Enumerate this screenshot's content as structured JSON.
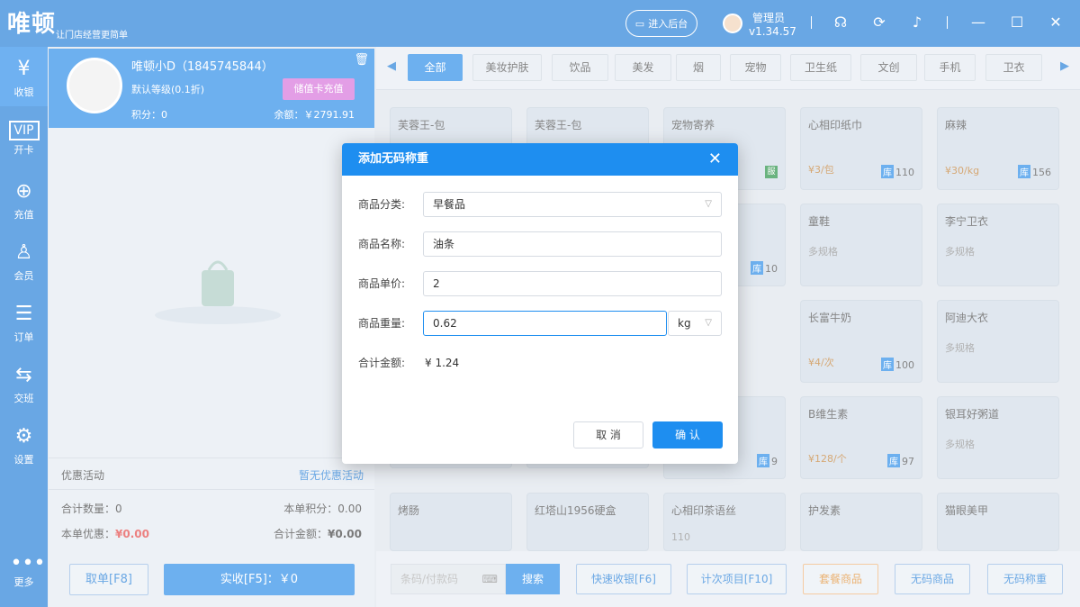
{
  "topbar": {
    "logo": "唯顿",
    "slogan": "让门店经营更简单",
    "admin_label": "进入后台",
    "user_name": "管理员",
    "version": "v1.34.57"
  },
  "nav": [
    {
      "label": "收银",
      "icon": "cashier-icon"
    },
    {
      "label": "开卡",
      "icon": "vip-card-icon"
    },
    {
      "label": "充值",
      "icon": "recharge-icon"
    },
    {
      "label": "会员",
      "icon": "member-icon"
    },
    {
      "label": "订单",
      "icon": "order-icon"
    },
    {
      "label": "交班",
      "icon": "shift-icon"
    },
    {
      "label": "设置",
      "icon": "settings-icon"
    },
    {
      "label": "更多",
      "icon": "more-icon"
    }
  ],
  "member": {
    "name": "唯顿小D（1845745844）",
    "level": "默认等级(0.1折)",
    "points": "积分：0",
    "balance": "余额：￥2791.91",
    "charge_label": "储值卡充值"
  },
  "summary": {
    "promo_label": "优惠活动",
    "promo_value": "暂无优惠活动",
    "count_label": "合计数量：0",
    "points_label": "本单积分：0.00",
    "discount_label": "本单优惠：",
    "discount_value": "¥0.00",
    "total_label": "合计金额：",
    "total_value": "¥0.00",
    "cancel_order": "取单[F8]",
    "pay": "实收[F5]：￥0"
  },
  "categories": [
    "全部",
    "美妆护肤",
    "饮品",
    "美发",
    "烟",
    "宠物",
    "卫生纸",
    "文创",
    "手机",
    "卫衣"
  ],
  "products": [
    {
      "name": "芙蓉王-包"
    },
    {
      "name": "芙蓉王-包"
    },
    {
      "name": "宠物寄养",
      "badge": "服"
    },
    {
      "name": "心相印纸巾",
      "price": "¥3/包",
      "stock": "110"
    },
    {
      "name": "麻辣",
      "price": "¥30/kg",
      "stock": "156"
    },
    {
      "name": "",
      "stock": "10"
    },
    {
      "name": "童鞋",
      "spec": "多规格"
    },
    {
      "name": "李宁卫衣",
      "spec": "多规格"
    },
    {
      "name": "长富牛奶",
      "price": "¥4/次",
      "stock": "100"
    },
    {
      "name": "阿迪大衣",
      "spec": "多规格"
    },
    {
      "name": "",
      "stock": "9"
    },
    {
      "name": "B维生素",
      "price": "¥128/个",
      "stock": "97"
    },
    {
      "name": "银耳好粥道",
      "spec": "多规格"
    },
    {
      "name": "烤肠"
    },
    {
      "name": "红塔山1956硬盒"
    },
    {
      "name": "心相印茶语丝",
      "spec": "110"
    },
    {
      "name": "护发素"
    },
    {
      "name": "猫眼美甲"
    }
  ],
  "stock_tag": "库",
  "bottom": {
    "barcode_placeholder": "条码/付款码",
    "search": "搜索",
    "quick": "快速收银[F6]",
    "count_item": "计次项目[F10]",
    "combo": "套餐商品",
    "nocode": "无码商品",
    "nocode_weigh": "无码称重"
  },
  "dialog": {
    "title": "添加无码称重",
    "category_label": "商品分类:",
    "category_value": "早餐品",
    "name_label": "商品名称:",
    "name_value": "油条",
    "price_label": "商品单价:",
    "price_value": "2",
    "weight_label": "商品重量:",
    "weight_value": "0.62",
    "unit": "kg",
    "total_label": "合计金额:",
    "total_value": "¥ 1.24",
    "cancel": "取 消",
    "confirm": "确 认"
  }
}
